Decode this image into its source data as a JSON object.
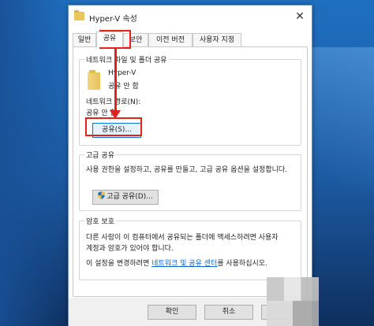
{
  "window": {
    "title": "Hyper-V 속성",
    "close_glyph": "✕"
  },
  "tabs": [
    {
      "label": "일반"
    },
    {
      "label": "공유"
    },
    {
      "label": "보안"
    },
    {
      "label": "이전 버전"
    },
    {
      "label": "사용자 지정"
    }
  ],
  "network_share": {
    "group_title": "네트워크 파일 및 폴더 공유",
    "folder_name": "Hyper-V",
    "folder_status": "공유 안 함",
    "path_label": "네트워크 경로(N):",
    "path_value": "공유 안 함",
    "share_button": "공유(S)..."
  },
  "advanced_share": {
    "group_title": "고급 공유",
    "description": "사용 권한을 설정하고, 공유를 만들고, 고급 공유 옵션을 설정합니다.",
    "button": "고급 공유(D)..."
  },
  "password_protect": {
    "group_title": "암호 보호",
    "line1": "다른 사람이 이 컴퓨터에서 공유되는 폴더에 액세스하려면 사용자",
    "line2": "계정과 암호가 있어야 합니다.",
    "line3_prefix": "이 설정을 변경하려면",
    "link": "네트워크 및 공유 센터",
    "line3_suffix": "를 사용하십시오."
  },
  "footer": {
    "ok": "확인",
    "cancel": "취소"
  },
  "colors": {
    "annotation": "#e0241b",
    "link": "#0b63ce",
    "focus": "#0078d7"
  }
}
